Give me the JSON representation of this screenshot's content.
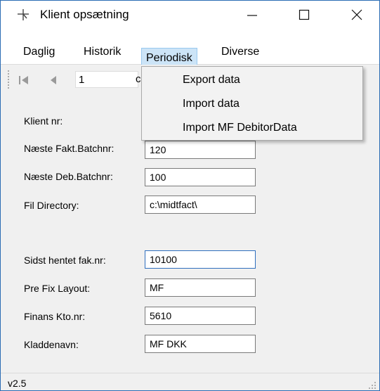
{
  "window": {
    "title": "Klient opsætning"
  },
  "menu": {
    "items": [
      "Daglig",
      "Historik",
      "Periodisk",
      "Diverse"
    ],
    "open_index": 2,
    "dropdown": [
      "Export data",
      "Import data",
      "Import MF DebitorData"
    ]
  },
  "toolbar": {
    "position": "1",
    "of_prefix": "c"
  },
  "form": {
    "fields": [
      {
        "label": "Klient nr:",
        "value": ""
      },
      {
        "label": "Næste Fakt.Batchnr:",
        "value": "120"
      },
      {
        "label": "Næste Deb.Batchnr:",
        "value": "100"
      },
      {
        "label": "Fil Directory:",
        "value": "c:\\midtfact\\"
      },
      {
        "label": "Sidst hentet fak.nr:",
        "value": "10100"
      },
      {
        "label": "Pre Fix Layout:",
        "value": "MF"
      },
      {
        "label": "Finans Kto.nr:",
        "value": "5610"
      },
      {
        "label": "Kladdenavn:",
        "value": "MF DKK"
      }
    ]
  },
  "status": {
    "version": "v2.5"
  }
}
